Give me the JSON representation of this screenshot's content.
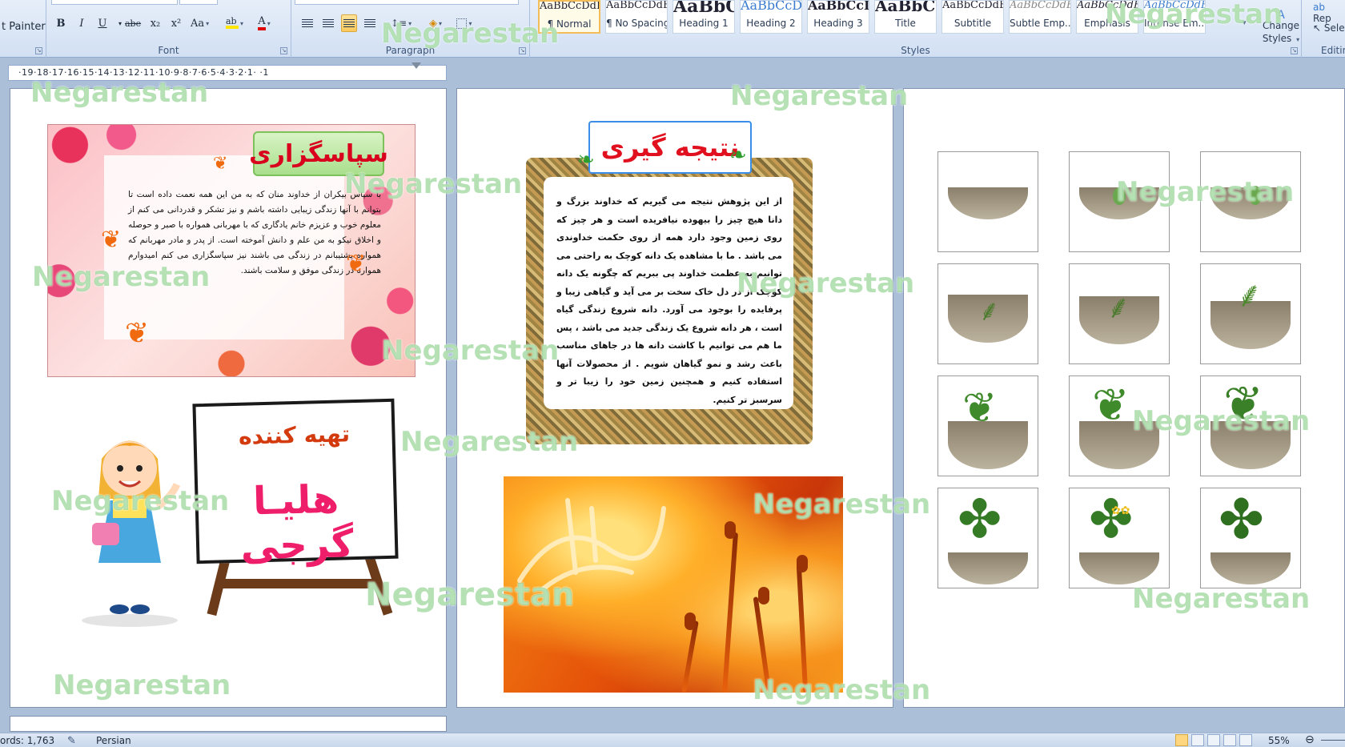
{
  "ribbon": {
    "clipboard": {
      "format_painter": "t Painter"
    },
    "font": {
      "label": "Font",
      "bold": "B",
      "italic": "I",
      "underline": "U",
      "strike": "abe",
      "subscript": "x₂",
      "superscript": "x²",
      "case": "Aa",
      "color_glyph": "A"
    },
    "paragraph": {
      "label": "Paragraph"
    },
    "styles": {
      "label": "Styles",
      "items": [
        {
          "preview": "AaBbCcDdEe",
          "name": "¶ Normal"
        },
        {
          "preview": "AaBbCcDdEe",
          "name": "¶ No Spacing"
        },
        {
          "preview": "AaBbC",
          "name": "Heading 1"
        },
        {
          "preview": "AaBbCcDdEe",
          "name": "Heading 2"
        },
        {
          "preview": "AaBbCcDdEe",
          "name": "Heading 3"
        },
        {
          "preview": "AaBbCcDdEe",
          "name": "Title"
        },
        {
          "preview": "AaBbCcDdEe",
          "name": "Subtitle"
        },
        {
          "preview": "AaBbCcDdEe",
          "name": "Subtle Emp..."
        },
        {
          "preview": "AaBbCcDdEe",
          "name": "Emphasis"
        },
        {
          "preview": "AaBbCcDdEe",
          "name": "Intense Em..."
        }
      ],
      "change_styles_1": "Change",
      "change_styles_2": "Styles"
    },
    "editing": {
      "label": "Editin",
      "replace": "Rep",
      "select": "Sele"
    }
  },
  "ruler": {
    "marks": "·19·18·17·16·15·14·13·12·11·10·9·8·7·6·5·4·3·2·1· ·1"
  },
  "page1": {
    "card_title": "سپاسگزاری",
    "card_text": "با سپاس بیکران از خداوند منان که به من این همه نعمت داده است تا بتوانم با آنها زندگی زیبایی داشته باشم و نیز تشکر و قدردانی می کنم از معلوم خوب و عزیزم خانم یادگاری که با مهربانی همواره با صبر و حوصله و اخلاق نیکو به من علم و دانش آموخته است. از پدر و مادر مهربانم که همواره پشتیبانم در زندگی می باشند نیز سپاسگزاری می کنم امیدوارم همواره در زندگی موفق و سلامت باشند.",
    "board_sub": "تهیه کننده",
    "board_name": "هلیـا گرجی"
  },
  "page2": {
    "card_title": "نتیجه گیری",
    "card_text": "از این پژوهش نتیجه می گیریم که خداوند بزرگ و دانا هیچ چیز را بیهوده نیافریده است و هر چیز که روی زمین وجود دارد همه از روی حکمت خداوندی می باشد . ما با مشاهده یک دانه کوچک به راحتی می توانیم به عظمت خداوند پی ببریم که چگونه یک دانه کوچک از در دل خاک سخت بر می آید و گیاهی زیبا و پرفایده را بوجود می آورد. دانه شروع زندگی گیاه است ، هر دانه شروع یک زندگی جدید می باشد ، پس ما هم می توانیم با کاشت دانه ها در جاهای مناسب باعث رشد و نمو گیاهان شویم . از محصولات آنها استفاده کنیم و همچنین زمین خود را زیبا تر و سرسبز تر کنیم."
  },
  "page3": {
    "stages": 12
  },
  "watermark": "Negarestan",
  "status": {
    "words": "ords: 1,763",
    "language": "Persian",
    "zoom": "55%"
  }
}
